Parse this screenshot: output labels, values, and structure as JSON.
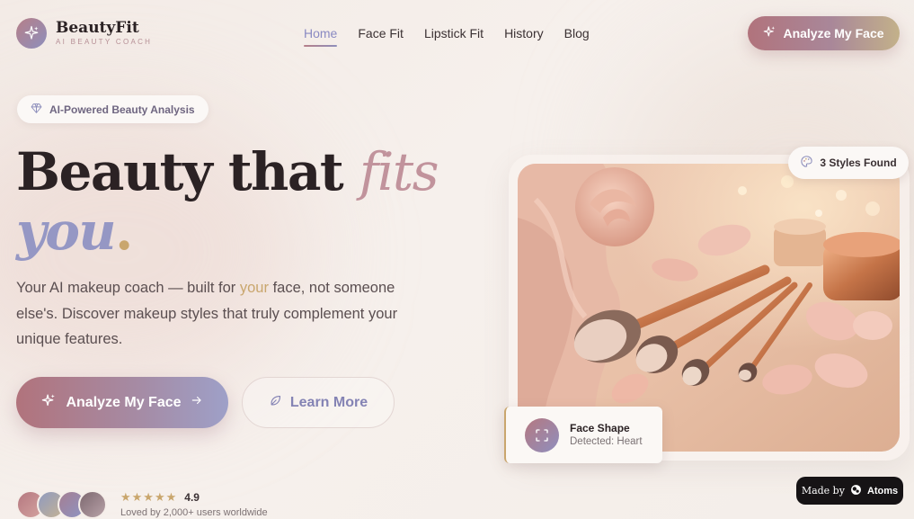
{
  "header": {
    "brand": "BeautyFit",
    "tagline": "AI BEAUTY COACH",
    "nav": [
      {
        "label": "Home",
        "active": true
      },
      {
        "label": "Face Fit",
        "active": false
      },
      {
        "label": "Lipstick Fit",
        "active": false
      },
      {
        "label": "History",
        "active": false
      },
      {
        "label": "Blog",
        "active": false
      }
    ],
    "cta_label": "Analyze My Face"
  },
  "badge": {
    "label": "AI-Powered Beauty Analysis",
    "icon": "diamond-icon"
  },
  "hero": {
    "headline_line1_plain": "Beauty that",
    "headline_line1_italic": "fits",
    "headline_line2_italic": "you",
    "headline_dot": ".",
    "lead_before": "Your AI makeup coach — built for ",
    "lead_highlight": "your",
    "lead_after": " face, not someone else's. Discover makeup styles that truly complement your unique features.",
    "primary_label": "Analyze My Face",
    "secondary_label": "Learn More"
  },
  "social_proof": {
    "stars": "★★★★★",
    "rating": "4.9",
    "caption": "Loved by 2,000+ users worldwide"
  },
  "visual": {
    "styles_found": "3 Styles Found",
    "face_shape_title": "Face Shape",
    "face_shape_value": "Detected: Heart"
  },
  "made_by": {
    "prefix": "Made by",
    "brand": "Atoms"
  },
  "colors": {
    "accent_rose": "#b1737c",
    "accent_lavender": "#9597c4",
    "accent_gold": "#c9a66d",
    "text_dark": "#2b2224"
  }
}
